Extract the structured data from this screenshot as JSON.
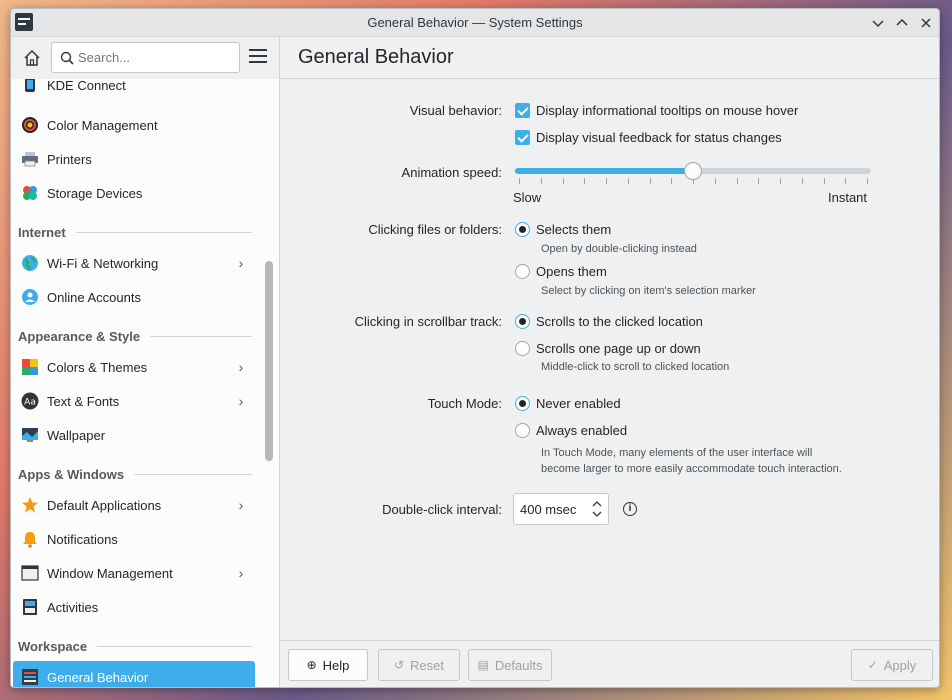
{
  "window": {
    "title": "General Behavior — System Settings"
  },
  "toolbar": {
    "search_placeholder": "Search..."
  },
  "page": {
    "title": "General Behavior"
  },
  "sidebar": {
    "items_top": [
      {
        "label": "KDE Connect",
        "icon": "kde-connect-icon"
      },
      {
        "label": "Color Management",
        "icon": "color-management-icon"
      },
      {
        "label": "Printers",
        "icon": "printer-icon"
      },
      {
        "label": "Storage Devices",
        "icon": "storage-devices-icon"
      }
    ],
    "headings": [
      "Internet",
      "Appearance & Style",
      "Apps & Windows",
      "Workspace"
    ],
    "internet": [
      {
        "label": "Wi-Fi & Networking",
        "icon": "globe-icon"
      },
      {
        "label": "Online Accounts",
        "icon": "online-accounts-icon"
      }
    ],
    "appearance": [
      {
        "label": "Colors & Themes",
        "icon": "colors-themes-icon"
      },
      {
        "label": "Text & Fonts",
        "icon": "text-fonts-icon"
      },
      {
        "label": "Wallpaper",
        "icon": "wallpaper-icon"
      }
    ],
    "apps": [
      {
        "label": "Default Applications",
        "icon": "star-icon"
      },
      {
        "label": "Notifications",
        "icon": "bell-icon"
      },
      {
        "label": "Window Management",
        "icon": "window-management-icon"
      },
      {
        "label": "Activities",
        "icon": "activities-icon"
      }
    ],
    "workspace": [
      {
        "label": "General Behavior",
        "icon": "general-behavior-icon"
      }
    ]
  },
  "settings": {
    "visual_behavior": {
      "label": "Visual behavior:",
      "opt1": "Display informational tooltips on mouse hover",
      "opt2": "Display visual feedback for status changes"
    },
    "animation_speed": {
      "label": "Animation speed:",
      "min_label": "Slow",
      "max_label": "Instant",
      "value_fraction": 0.5
    },
    "clicking_files": {
      "label": "Clicking files or folders:",
      "opt1": "Selects them",
      "opt1_hint": "Open by double-clicking instead",
      "opt2": "Opens them",
      "opt2_hint": "Select by clicking on item's selection marker"
    },
    "scrollbar_track": {
      "label": "Clicking in scrollbar track:",
      "opt1": "Scrolls to the clicked location",
      "opt2": "Scrolls one page up or down",
      "opt2_hint": "Middle-click to scroll to clicked location"
    },
    "touch_mode": {
      "label": "Touch Mode:",
      "opt1": "Never enabled",
      "opt2": "Always enabled",
      "hint_line1": "In Touch Mode, many elements of the user interface will",
      "hint_line2": "become larger to more easily accommodate touch interaction."
    },
    "double_click": {
      "label": "Double-click interval:",
      "value": "400 msec"
    }
  },
  "footer": {
    "help": "Help",
    "reset": "Reset",
    "defaults": "Defaults",
    "apply": "Apply"
  }
}
